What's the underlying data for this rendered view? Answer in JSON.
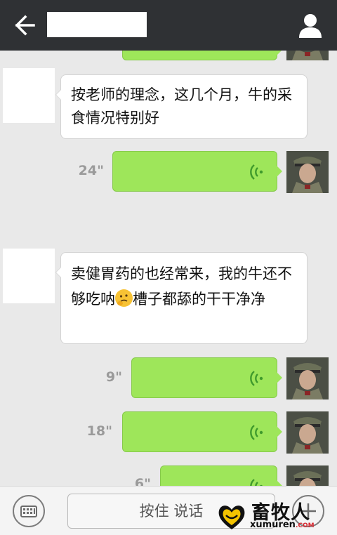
{
  "header": {
    "back_icon": "arrow-left-icon",
    "title": "",
    "profile_icon": "person-icon"
  },
  "messages": [
    {
      "side": "right",
      "kind": "voice",
      "duration": ""
    },
    {
      "side": "left",
      "kind": "text",
      "text": "按老师的理念，这几个月，牛的采食情况特别好"
    },
    {
      "side": "right",
      "kind": "voice",
      "duration": "24\""
    },
    {
      "side": "left",
      "kind": "text",
      "text_part1": "卖健胃药的也经常来，我的牛还不够吃呐",
      "emoji": "thinking-face-emoji",
      "text_part2": "槽子都舔的干干净净"
    },
    {
      "side": "right",
      "kind": "voice",
      "duration": "9\""
    },
    {
      "side": "right",
      "kind": "voice",
      "duration": "18\""
    },
    {
      "side": "right",
      "kind": "voice",
      "duration": "6\""
    }
  ],
  "footer": {
    "keyboard_icon": "keyboard-icon",
    "hold_to_talk": "按住 说话",
    "plus_icon": "plus-icon"
  },
  "watermark": {
    "brand": "畜牧人",
    "domain": "xumuren",
    "domain_suffix": ".COM"
  },
  "colors": {
    "topbar": "#2f3134",
    "voice_bubble": "#9ee65a",
    "background": "#e9e9e9"
  }
}
